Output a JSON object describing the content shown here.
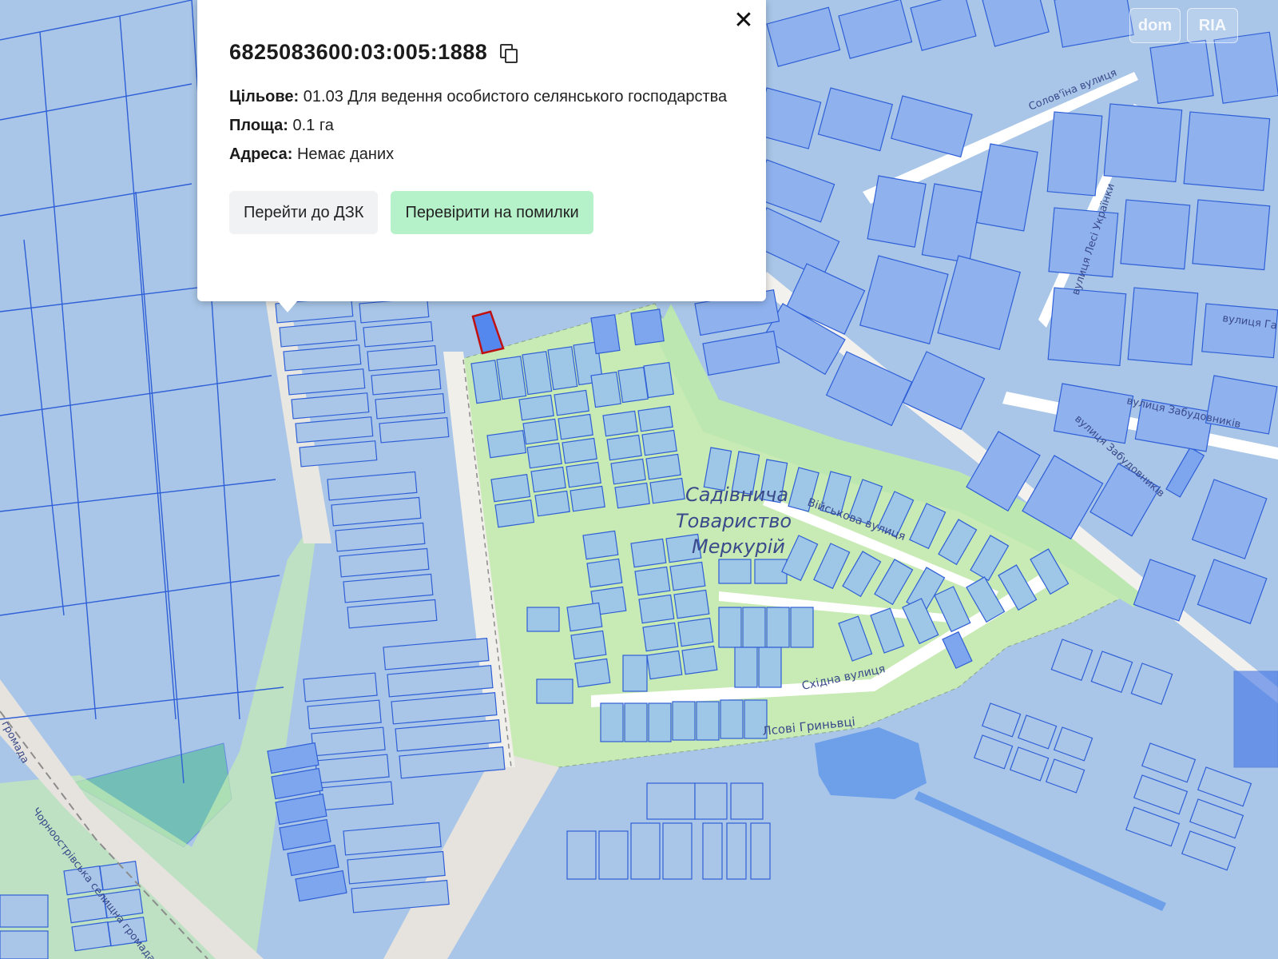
{
  "popup": {
    "cadastral_number": "6825083600:03:005:1888",
    "purpose_label": "Цільове:",
    "purpose_value": "01.03 Для ведення особистого селянського господарства",
    "area_label": "Площа:",
    "area_value": "0.1 га",
    "address_label": "Адреса:",
    "address_value": "Немає даних",
    "button_dzk": "Перейти до ДЗК",
    "button_check": "Перевірити на помилки",
    "close_icon": "close-icon",
    "copy_icon": "copy-icon"
  },
  "map_labels": {
    "street_soloviina": "Солов'їна вулиця",
    "street_lesi_ukrainky": "вулиця Лесі Українки",
    "street_zabudovnykiv": "вулиця Забудовників",
    "street_viiskova": "Військова вулиця",
    "street_skhidna": "Східна вулиця",
    "street_partial_top": "вулиця Га",
    "place_yasovi": "Лсові Гриньвці",
    "garden_line1": "Садівнича",
    "garden_line2": "Товариство",
    "garden_line3": "Меркурій",
    "hromada_line": "Чорноострівська селищна громада",
    "hromada_short": "громада"
  },
  "watermarks": [
    "dom",
    "RIA"
  ],
  "colors": {
    "parcel_fill": "#a7c4e6",
    "parcel_dark": "#7ea6ee",
    "parcel_stroke": "#2f5fd6",
    "road": "#e6e3de",
    "green": "#c8eab4",
    "water": "#6ea0ea",
    "selected": "#5588ee",
    "selected_stroke": "#c01010",
    "button_green": "#b6f2c9"
  }
}
